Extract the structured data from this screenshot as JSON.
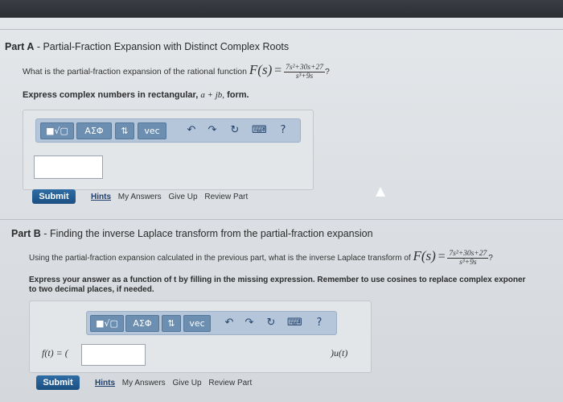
{
  "partA": {
    "title_prefix": "Part A",
    "title_text": "Partial-Fraction Expansion with Distinct Complex Roots",
    "question": "What is the partial-fraction expansion of the rational function",
    "func_lhs": "F(s)",
    "func_num": "7s²+30s+27",
    "func_den": "s³+9s",
    "func_end": "?",
    "instruction_pre": "Express complex numbers in rectangular,",
    "instruction_math": "a + jb,",
    "instruction_post": "form.",
    "submit": "Submit",
    "links": [
      "Hints",
      "My Answers",
      "Give Up",
      "Review Part"
    ]
  },
  "partB": {
    "title_prefix": "Part B",
    "title_text": "Finding the inverse Laplace transform from the partial-fraction expansion",
    "question": "Using the partial-fraction expansion calculated in the previous part, what is the inverse Laplace transform of",
    "func_lhs": "F(s)",
    "func_num": "7s²+30s+27",
    "func_den": "s³+9s",
    "func_end": "?",
    "instruction_line1": "Express your answer as a function of t by filling in the missing expression. Remember to use cosines to replace complex exponer",
    "instruction_line2": "to two decimal places, if needed.",
    "answer_prefix": "f(t) = (",
    "answer_suffix": ")u(t)",
    "submit": "Submit",
    "links": [
      "Hints",
      "My Answers",
      "Give Up",
      "Review Part"
    ]
  },
  "toolbar": {
    "template_label": "■√▢",
    "greek_label": "ΑΣΦ",
    "arrows_label": "⇅",
    "vec_label": "vec",
    "undo_icon": "↶",
    "redo_icon": "↷",
    "reset_icon": "↻",
    "keyboard_icon": "⌨",
    "help_label": "?"
  }
}
